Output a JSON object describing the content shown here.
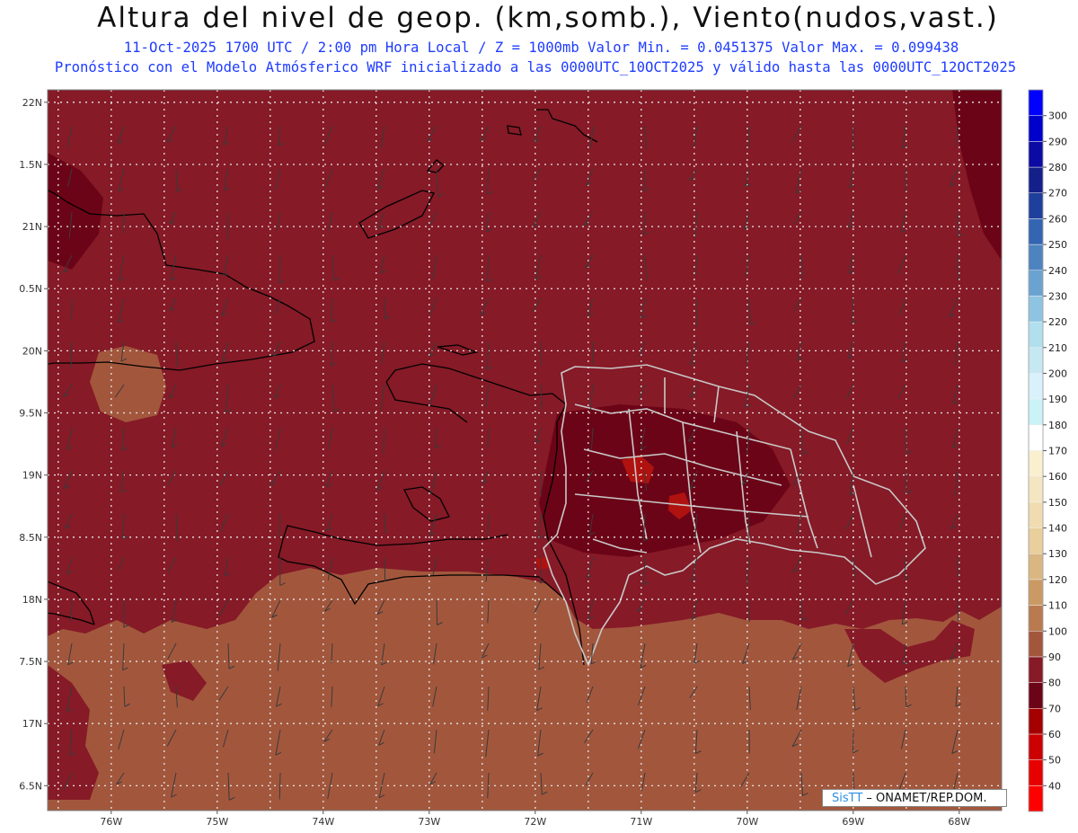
{
  "header": {
    "title": "Altura del nivel de geop. (km,somb.), Viento(nudos,vast.)",
    "subtitle_line1": "11-Oct-2025  1700 UTC / 2:00 pm Hora Local / Z = 1000mb  Valor Min. = 0.0451375  Valor Max. = 0.099438",
    "subtitle_line2": "Pronóstico con el Modelo Atmósferico WRF inicializado a las 0000UTC_10OCT2025 y válido hasta las  0000UTC_12OCT2025"
  },
  "colors": {
    "title": "#111111",
    "subtitle": "#1f3cff",
    "band_80_90": "#861a27",
    "band_90_100": "#a2573d",
    "band_70_80": "#6c0417",
    "band_60_70": "#b0120f",
    "coastline": "#000000",
    "province_border": "#c8c8c8",
    "grid": "#e6e6e6"
  },
  "map": {
    "lon_range": [
      -76.6,
      -67.6
    ],
    "lat_range": [
      16.3,
      22.1
    ],
    "lat_ticks": [
      {
        "value": 22.0,
        "label": "22N"
      },
      {
        "value": 21.5,
        "label": "1.5N"
      },
      {
        "value": 21.0,
        "label": "21N"
      },
      {
        "value": 20.5,
        "label": "0.5N"
      },
      {
        "value": 20.0,
        "label": "20N"
      },
      {
        "value": 19.5,
        "label": "9.5N"
      },
      {
        "value": 19.0,
        "label": "19N"
      },
      {
        "value": 18.5,
        "label": "8.5N"
      },
      {
        "value": 18.0,
        "label": "18N"
      },
      {
        "value": 17.5,
        "label": "7.5N"
      },
      {
        "value": 17.0,
        "label": "17N"
      },
      {
        "value": 16.5,
        "label": "6.5N"
      }
    ],
    "lon_ticks": [
      {
        "value": -76,
        "label": "76W"
      },
      {
        "value": -75,
        "label": "75W"
      },
      {
        "value": -74,
        "label": "74W"
      },
      {
        "value": -73,
        "label": "73W"
      },
      {
        "value": -72,
        "label": "72W"
      },
      {
        "value": -71,
        "label": "71W"
      },
      {
        "value": -70,
        "label": "70W"
      },
      {
        "value": -69,
        "label": "69W"
      },
      {
        "value": -68,
        "label": "68W"
      }
    ],
    "grid_spacing_deg": 0.5,
    "wind_barbs_shown": true
  },
  "colorbar": {
    "levels": [
      "40",
      "50",
      "60",
      "70",
      "80",
      "90",
      "100",
      "110",
      "120",
      "130",
      "140",
      "150",
      "160",
      "170",
      "180",
      "190",
      "200",
      "210",
      "220",
      "230",
      "240",
      "250",
      "260",
      "270",
      "280",
      "290",
      "300"
    ],
    "colors": [
      "#ff0000",
      "#e60000",
      "#cc0000",
      "#a50000",
      "#6c0417",
      "#861a27",
      "#a2573d",
      "#b97a4f",
      "#c99a63",
      "#dab782",
      "#e8cf9c",
      "#f0dcb0",
      "#f5e6c2",
      "#faf0d0",
      "#ffffff",
      "#c9f3f7",
      "#d9f1fb",
      "#c5e8f3",
      "#b1dfee",
      "#8ec4e2",
      "#6aa3d0",
      "#4d84c0",
      "#3365b2",
      "#1f3f9c",
      "#14208a",
      "#0b0aa3",
      "#0000cc",
      "#0000ff"
    ]
  },
  "credit": {
    "brand": "SisTT",
    "org": " – ONAMET/REP.DOM."
  }
}
